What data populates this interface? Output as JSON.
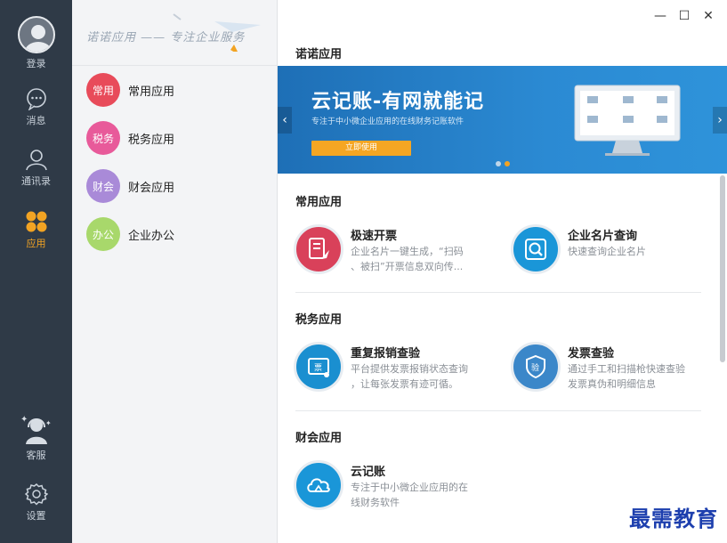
{
  "rail": {
    "login": "登录",
    "messages": "消息",
    "contacts": "通讯录",
    "apps": "应用",
    "support": "客服",
    "settings": "设置",
    "active_color": "#f2a323"
  },
  "category_panel": {
    "slogan": "诺诺应用 —— 专注企业服务",
    "items": [
      {
        "badge": "常用",
        "label": "常用应用",
        "color": "#e84b5a"
      },
      {
        "badge": "税务",
        "label": "税务应用",
        "color": "#e85a9a"
      },
      {
        "badge": "财会",
        "label": "财会应用",
        "color": "#a98ad8"
      },
      {
        "badge": "办公",
        "label": "企业办公",
        "color": "#a8d86b"
      }
    ]
  },
  "window": {
    "minimize": "—",
    "maximize": "☐",
    "close": "✕"
  },
  "main": {
    "header": "诺诺应用",
    "banner": {
      "title": "云记账-有网就能记",
      "subtitle": "专注于中小微企业应用的在线财务记账软件",
      "button": "立即使用",
      "prev": "‹",
      "next": "›",
      "slide_count": 2,
      "active_slide": 2
    },
    "sections": [
      {
        "title": "常用应用",
        "apps": [
          {
            "name": "极速开票",
            "desc_line1": "企业名片一键生成，“扫码",
            "desc_line2": "、被扫”开票信息双向传...",
            "icon": "invoice-icon",
            "color": "#d9415a"
          },
          {
            "name": "企业名片查询",
            "desc_line1": "快速查询企业名片",
            "desc_line2": "",
            "icon": "search-card-icon",
            "color": "#1a96d8"
          }
        ]
      },
      {
        "title": "税务应用",
        "apps": [
          {
            "name": "重复报销查验",
            "desc_line1": "平台提供发票报销状态查询",
            "desc_line2": "，让每张发票有迹可循。",
            "icon": "ticket-icon",
            "color": "#1a8fd0"
          },
          {
            "name": "发票查验",
            "desc_line1": "通过手工和扫描枪快速查验",
            "desc_line2": "发票真伪和明细信息",
            "icon": "shield-verify-icon",
            "color": "#3b87c9"
          }
        ]
      },
      {
        "title": "财会应用",
        "apps": [
          {
            "name": "云记账",
            "desc_line1": "专注于中小微企业应用的在",
            "desc_line2": "线财务软件",
            "icon": "cloud-icon",
            "color": "#1a96d8"
          }
        ]
      }
    ]
  },
  "watermark": "最需教育"
}
